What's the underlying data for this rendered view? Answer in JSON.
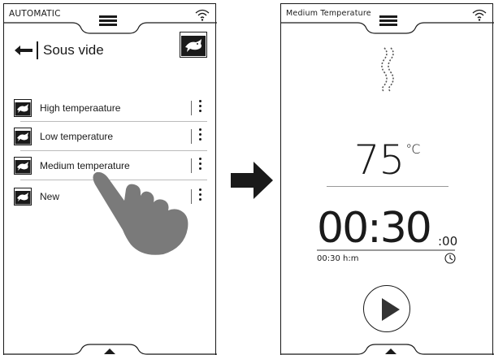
{
  "left_screen": {
    "mode_label": "AUTOMATIC",
    "title": "Sous vide",
    "items": [
      {
        "label": "High temperaature"
      },
      {
        "label": "Low temperature"
      },
      {
        "label": "Medium temperature"
      },
      {
        "label": "New"
      }
    ]
  },
  "right_screen": {
    "header_label": "Medium Temperature",
    "temperature": "75",
    "temperature_unit": "°C",
    "time": "00:30",
    "time_seconds": ":00",
    "time_setting": "00:30 h:m"
  },
  "icons": {
    "menu": "hamburger-menu-icon",
    "wifi": "wifi-icon",
    "back": "back-arrow-icon",
    "fish": "fish-icon",
    "more": "vertical-dots-icon",
    "steam": "steam-icon",
    "clock": "clock-icon",
    "play": "play-icon",
    "next": "right-arrow-icon",
    "tap": "tap-hand-icon"
  },
  "colors": {
    "ink": "#1a1a1a",
    "hand": "#7a7a7a",
    "divider": "#bbbbbb"
  }
}
